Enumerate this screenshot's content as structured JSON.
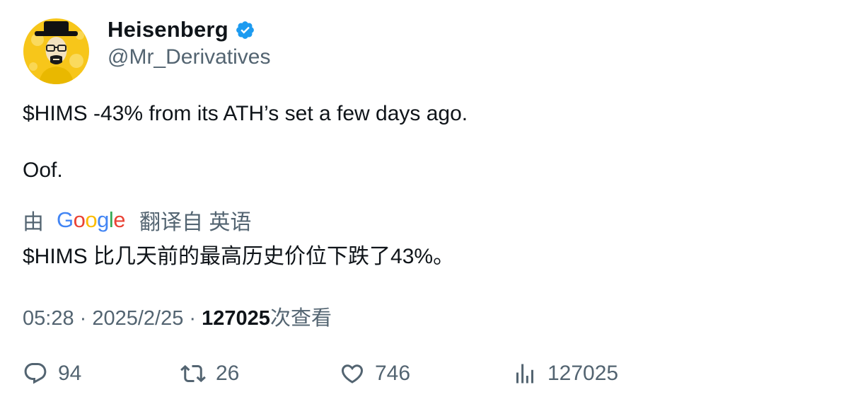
{
  "author": {
    "display_name": "Heisenberg",
    "handle": "@Mr_Derivatives",
    "verified": true,
    "verified_color": "#1d9bf0",
    "avatar_icon": "heisenberg-avatar-icon"
  },
  "tweet": {
    "line1": "$HIMS -43% from its ATH’s set a few days ago.",
    "line2": "Oof."
  },
  "translation": {
    "prefix": "由",
    "provider_logo": {
      "g1": "G",
      "o1": "o",
      "o2": "o",
      "g2": "g",
      "l": "l",
      "e": "e"
    },
    "suffix": "翻译自 英语",
    "text": "$HIMS 比几天前的最高历史价位下跌了43%。"
  },
  "meta": {
    "time": "05:28",
    "separator1": " · ",
    "date": "2025/2/25",
    "separator2": " · ",
    "views_count": "127025",
    "views_label": "次查看"
  },
  "actions": {
    "reply_count": "94",
    "retweet_count": "26",
    "like_count": "746",
    "views_count": "127025"
  },
  "colors": {
    "text_primary": "#0f1419",
    "text_secondary": "#536471",
    "avatar_bg": "#f7c61a"
  }
}
